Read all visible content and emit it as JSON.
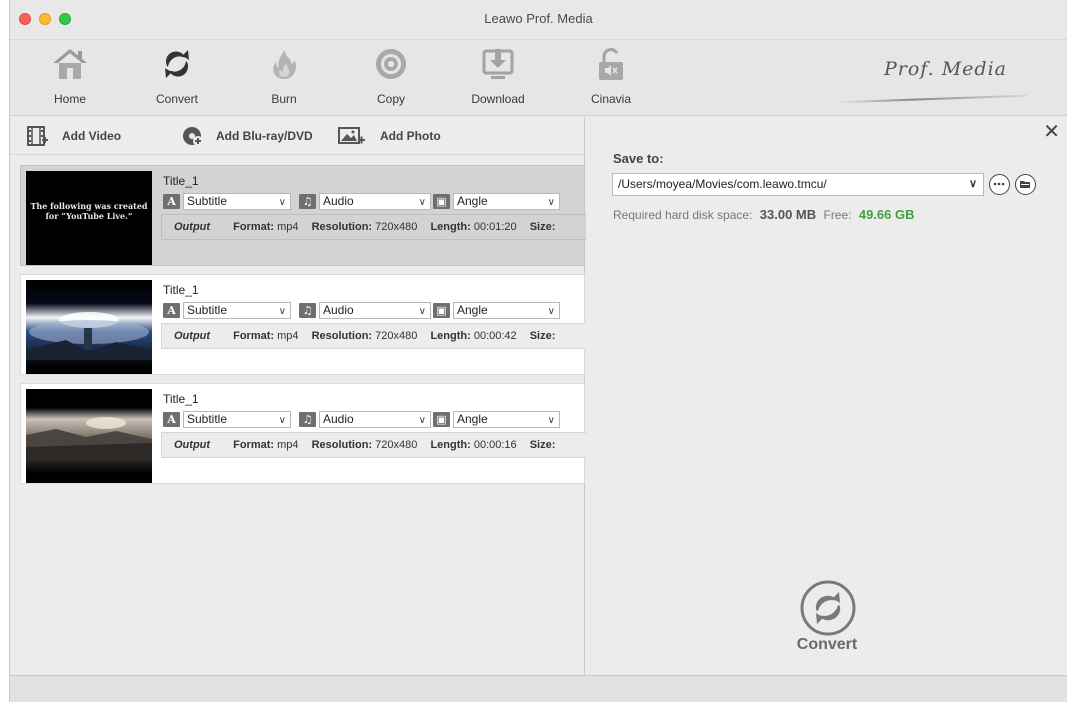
{
  "window": {
    "title": "Leawo Prof. Media",
    "traffic_lights": {
      "close": "#fc5f57",
      "minimize": "#fdbc2e",
      "zoom": "#34c84a"
    }
  },
  "toolbar": {
    "items": [
      {
        "label": "Home",
        "icon": "home-icon"
      },
      {
        "label": "Convert",
        "icon": "convert-icon"
      },
      {
        "label": "Burn",
        "icon": "burn-icon"
      },
      {
        "label": "Copy",
        "icon": "copy-icon"
      },
      {
        "label": "Download",
        "icon": "download-icon"
      },
      {
        "label": "Cinavia",
        "icon": "cinavia-icon"
      }
    ],
    "brand": "Prof. Media"
  },
  "add_bar": {
    "add_video": "Add Video",
    "add_bluray": "Add Blu-ray/DVD",
    "add_photo": "Add Photo"
  },
  "items": [
    {
      "title": "Title_1",
      "thumbnail_text": "The following was created for “YouTube Live.”",
      "subtitle": "Subtitle",
      "audio": "Audio",
      "angle": "Angle",
      "output_label": "Output",
      "format_label": "Format:",
      "format": "mp4",
      "resolution_label": "Resolution:",
      "resolution": "720x480",
      "length_label": "Length:",
      "length": "00:01:20",
      "size_label": "Size:",
      "selected": true
    },
    {
      "title": "Title_1",
      "subtitle": "Subtitle",
      "audio": "Audio",
      "angle": "Angle",
      "output_label": "Output",
      "format_label": "Format:",
      "format": "mp4",
      "resolution_label": "Resolution:",
      "resolution": "720x480",
      "length_label": "Length:",
      "length": "00:00:42",
      "size_label": "Size:",
      "selected": false
    },
    {
      "title": "Title_1",
      "subtitle": "Subtitle",
      "audio": "Audio",
      "angle": "Angle",
      "output_label": "Output",
      "format_label": "Format:",
      "format": "mp4",
      "resolution_label": "Resolution:",
      "resolution": "720x480",
      "length_label": "Length:",
      "length": "00:00:16",
      "size_label": "Size:",
      "selected": false
    }
  ],
  "right_panel": {
    "save_to_label": "Save to:",
    "save_path": "/Users/moyea/Movies/com.leawo.tmcu/",
    "required_label": "Required hard disk space:",
    "required_value": "33.00 MB",
    "free_label": "Free:",
    "free_value": "49.66 GB",
    "free_color": "#3fa33f",
    "convert_label": "Convert"
  }
}
